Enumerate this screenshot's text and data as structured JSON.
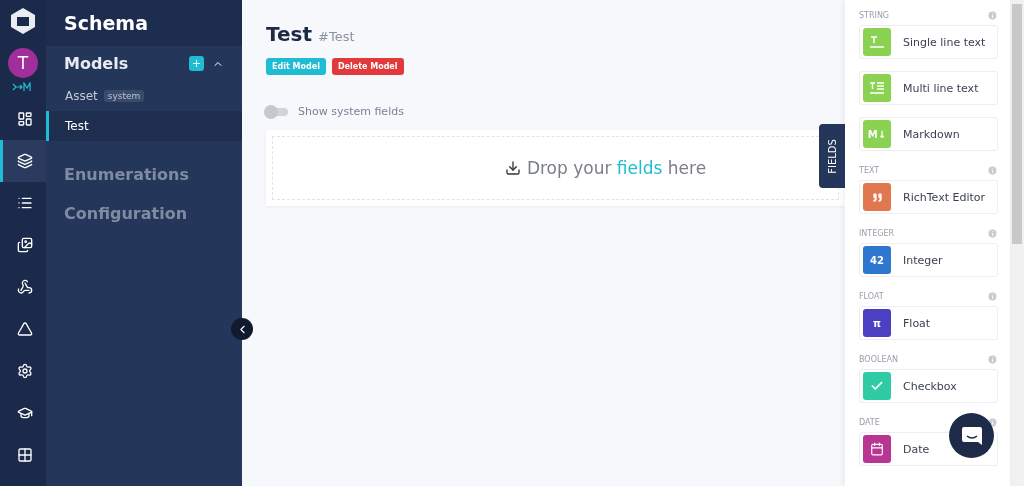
{
  "rail": {
    "avatar": "T",
    "items": [
      {
        "kind": "dashboard",
        "selected": false
      },
      {
        "kind": "layers",
        "selected": true
      },
      {
        "kind": "list",
        "selected": false
      },
      {
        "kind": "images",
        "selected": false
      },
      {
        "kind": "webhook",
        "selected": false
      },
      {
        "kind": "graph",
        "selected": false
      },
      {
        "kind": "settings",
        "selected": false
      },
      {
        "kind": "learn",
        "selected": false
      },
      {
        "kind": "apps",
        "selected": false
      }
    ]
  },
  "sidebar": {
    "title": "Schema",
    "models": {
      "title": "Models",
      "expanded": true,
      "items": [
        {
          "label": "Asset",
          "badge": "system",
          "selected": false
        },
        {
          "label": "Test",
          "selected": true
        }
      ]
    },
    "sections": [
      "Enumerations",
      "Configuration"
    ]
  },
  "main": {
    "title": "Test",
    "api_id": "#Test",
    "buttons": [
      {
        "label": "Edit Model",
        "kind": "primary"
      },
      {
        "label": "Delete Model",
        "kind": "danger"
      }
    ],
    "toggle": {
      "label": "Show system fields",
      "on": false
    },
    "drop": {
      "prefix": "Drop your",
      "highlight": "fields",
      "suffix": "here"
    },
    "fields_tab": "FIELDS"
  },
  "field_groups": [
    {
      "title": "STRING",
      "items": [
        {
          "label": "Single line text",
          "kind": "single",
          "color": "#8bd152"
        },
        {
          "label": "Multi line text",
          "kind": "multi",
          "color": "#8bd152"
        },
        {
          "label": "Markdown",
          "kind": "markdown",
          "color": "#8bd152",
          "icon_text": "M↓"
        }
      ]
    },
    {
      "title": "TEXT",
      "items": [
        {
          "label": "RichText Editor",
          "kind": "quote",
          "color": "#e0774f"
        }
      ]
    },
    {
      "title": "INTEGER",
      "items": [
        {
          "label": "Integer",
          "kind": "number",
          "color": "#2f78d0",
          "icon_text": "42"
        }
      ]
    },
    {
      "title": "FLOAT",
      "items": [
        {
          "label": "Float",
          "kind": "pi",
          "color": "#4b3fc2",
          "icon_text": "π"
        }
      ]
    },
    {
      "title": "BOOLEAN",
      "items": [
        {
          "label": "Checkbox",
          "kind": "check",
          "color": "#2fcba5"
        }
      ]
    },
    {
      "title": "DATE",
      "items": [
        {
          "label": "Date",
          "kind": "calendar",
          "color": "#b83592"
        }
      ]
    }
  ]
}
